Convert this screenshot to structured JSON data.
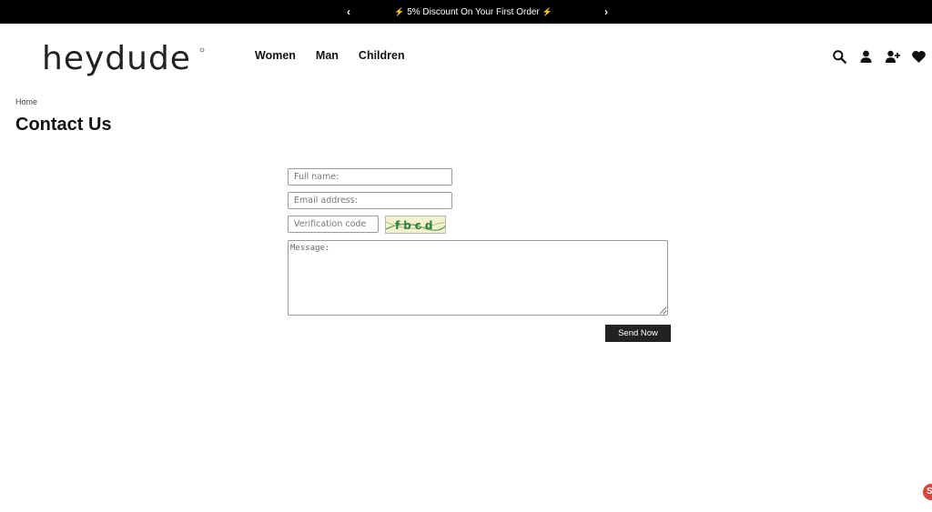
{
  "announcement": {
    "prev_label": "‹",
    "next_label": "›",
    "text": "5% Discount On Your First Order"
  },
  "header": {
    "logo_text": "heydude",
    "nav": [
      "Women",
      "Man",
      "Children"
    ],
    "icons": [
      "search-icon",
      "user-icon",
      "user-add-icon",
      "heart-icon"
    ]
  },
  "breadcrumb": "Home",
  "page_title": "Contact Us",
  "form": {
    "name_placeholder": "Full name:",
    "email_placeholder": "Email address:",
    "code_placeholder": "Verification code",
    "captcha_text": "fbcd",
    "message_placeholder": "Message:",
    "send_label": "Send Now"
  },
  "badge_text": "S",
  "colors": {
    "bar": "#000000",
    "button": "#222222",
    "captcha_bg": "#f4f1cf",
    "badge": "#d9443a"
  }
}
